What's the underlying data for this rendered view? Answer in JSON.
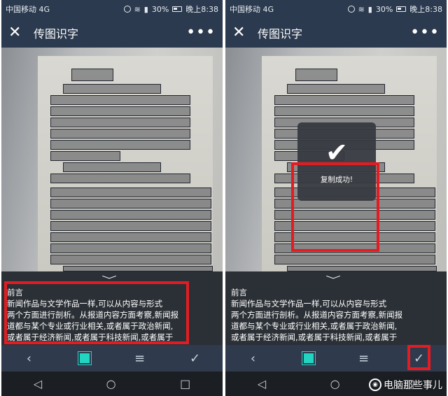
{
  "statusbar": {
    "carrier": "中国移动",
    "network_tag": "4G",
    "battery": "30%",
    "time": "晚上8:38"
  },
  "header": {
    "title": "传图识字"
  },
  "ocr_text": {
    "lines": [
      "前言",
      "新闻作品与文学作品一样,可以从内容与形式",
      "两个方面进行剖析。从报道内容方面考察,新闻报",
      "道都与某个专业或行业相关,或者属于政治新闻,",
      "或者属于经济新闻,或者属于科技新闻,或者属于"
    ]
  },
  "toast": {
    "message": "复制成功!"
  },
  "watermark": {
    "text": "电脑那些事儿"
  },
  "icons": {
    "close": "close-icon",
    "more": "more-icon",
    "chevron": "chevron-down-icon",
    "back": "back-icon",
    "crop": "crop-icon",
    "align": "align-icon",
    "confirm": "check-icon",
    "nav_back": "nav-back-icon",
    "nav_home": "nav-home-icon",
    "nav_recent": "nav-recent-icon"
  },
  "colors": {
    "accent": "#23d4c3",
    "highlight": "#e31c23",
    "header": "#2b3a4e"
  }
}
